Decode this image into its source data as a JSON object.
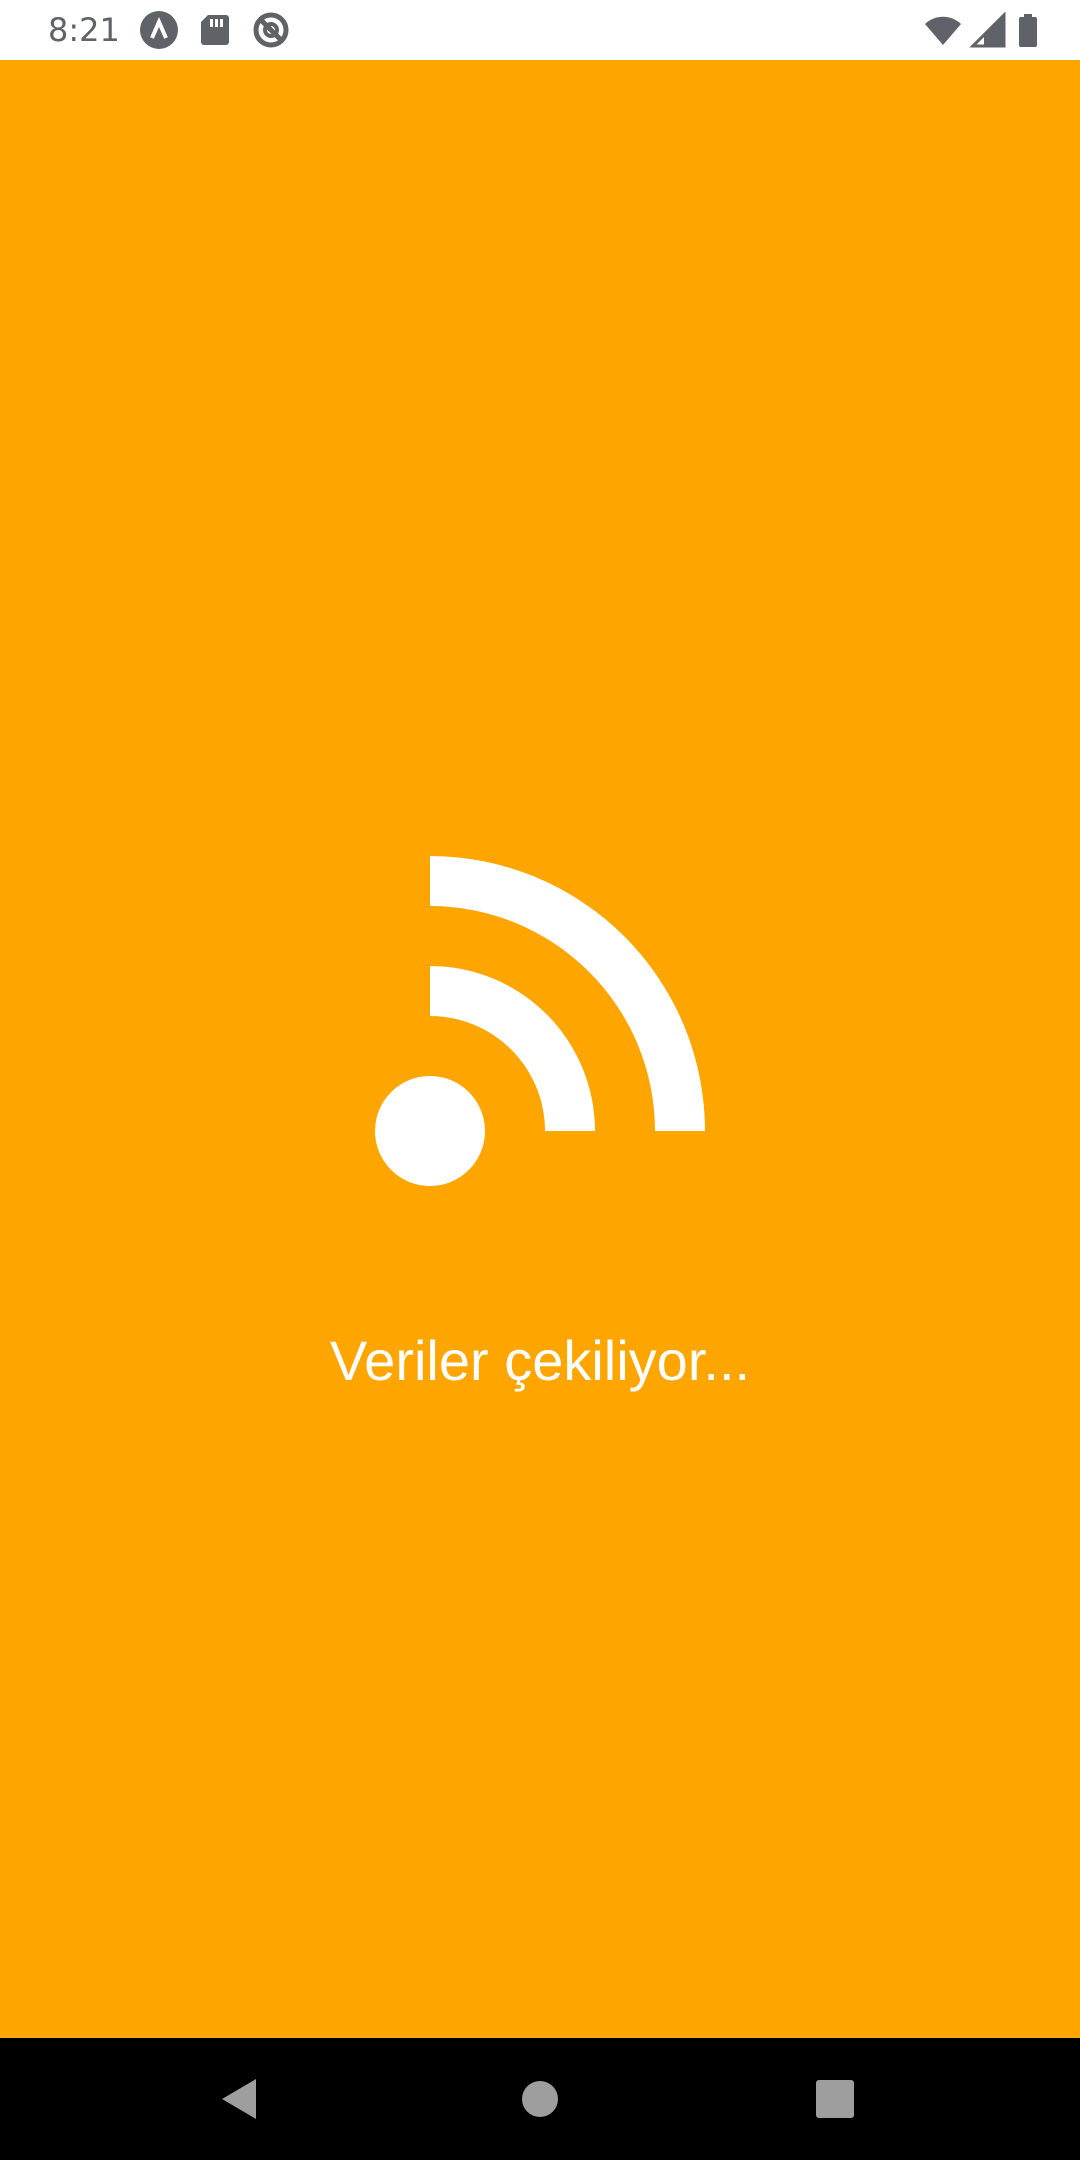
{
  "status_bar": {
    "time": "8:21",
    "left_icons": [
      "notification-a-icon",
      "sd-card-icon",
      "no-sync-icon"
    ],
    "right_icons": [
      "wifi-icon",
      "cellular-signal-icon",
      "battery-icon"
    ]
  },
  "main": {
    "icon": "rss-feed-icon",
    "loading_text": "Veriler çekiliyor...",
    "background_color": "#FFA500",
    "foreground_color": "#FFFFFF"
  },
  "nav_bar": {
    "buttons": [
      "back-icon",
      "home-icon",
      "recents-icon"
    ]
  }
}
